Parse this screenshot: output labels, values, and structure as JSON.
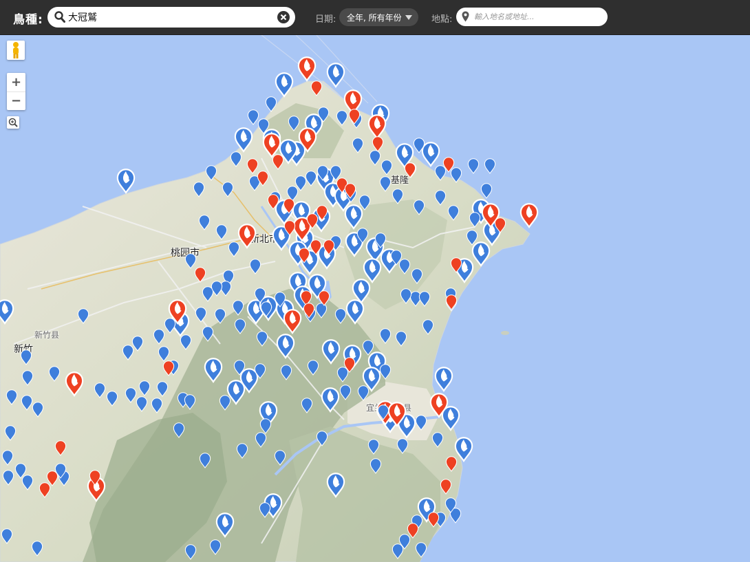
{
  "header": {
    "species_label": "鳥種:",
    "species_value": "大冠鷲",
    "date_label": "日期:",
    "date_value": "全年, 所有年份",
    "place_label": "地點:",
    "place_placeholder": "輸入地名或地址..."
  },
  "map": {
    "controls": {
      "zoom_in": "+",
      "zoom_out": "−"
    },
    "labels": {
      "taoyuan": "桃园市",
      "xinbei": "新北市",
      "keelung": "基隆",
      "hsinchu_county": "新竹县",
      "hsinchu": "新竹",
      "yilan": "宜兰县",
      "yilan_city": "宜兰"
    },
    "colors": {
      "sighting": "#3f7fdc",
      "recent_sighting": "#ee4122"
    }
  }
}
